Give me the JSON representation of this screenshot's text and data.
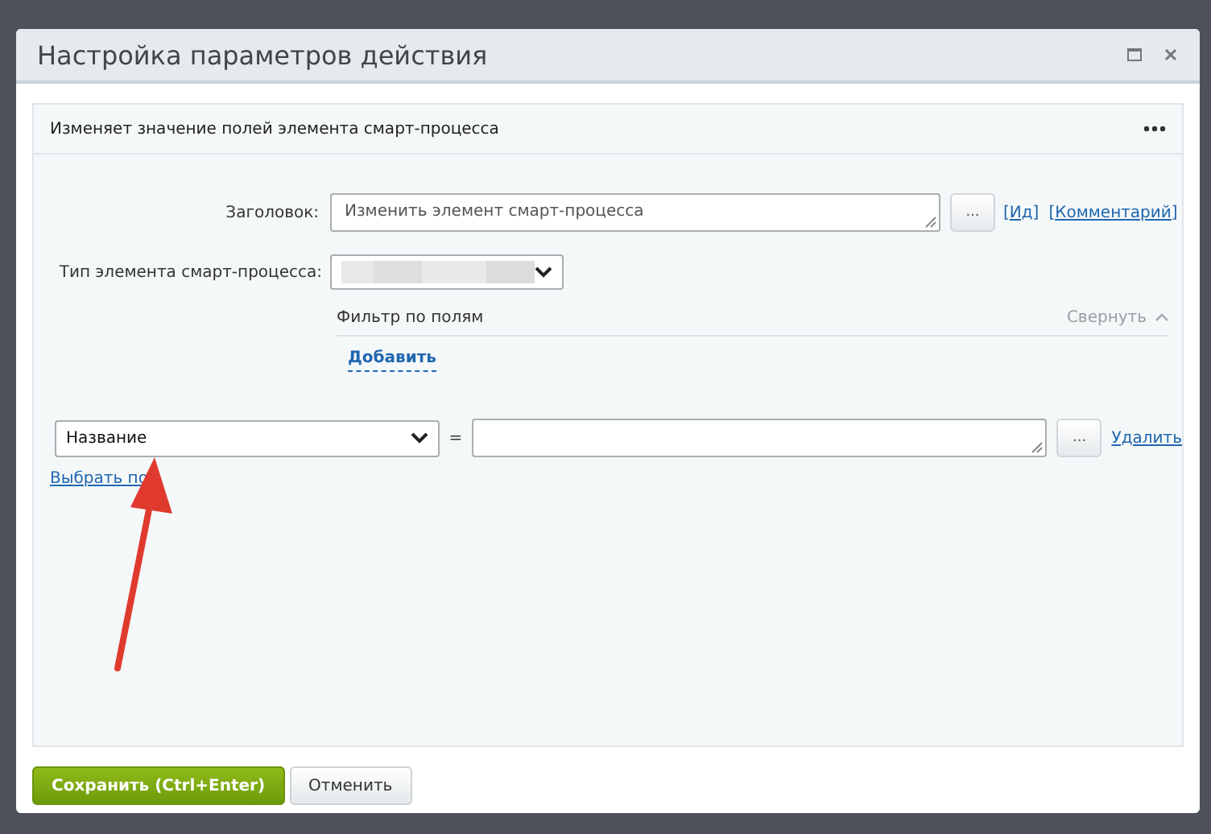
{
  "window": {
    "title": "Настройка параметров действия"
  },
  "panel": {
    "description": "Изменяет значение полей элемента смарт-процесса"
  },
  "title_field": {
    "label": "Заголовок:",
    "value": "Изменить элемент смарт-процесса",
    "button": "...",
    "links": [
      "[Ид]",
      "[Комментарий]"
    ]
  },
  "type_field": {
    "label": "Тип элемента смарт-процесса:"
  },
  "filter": {
    "title": "Фильтр по полям",
    "collapse": "Свернуть",
    "add": "Добавить"
  },
  "condition": {
    "field": "Название",
    "operator": "=",
    "button": "...",
    "remove": "Удалить"
  },
  "select_field_link": "Выбрать по",
  "buttons": [
    {
      "label": "Сохранить (Ctrl+Enter)",
      "kind": "primary"
    },
    {
      "label": "Отменить",
      "kind": "secondary"
    }
  ]
}
